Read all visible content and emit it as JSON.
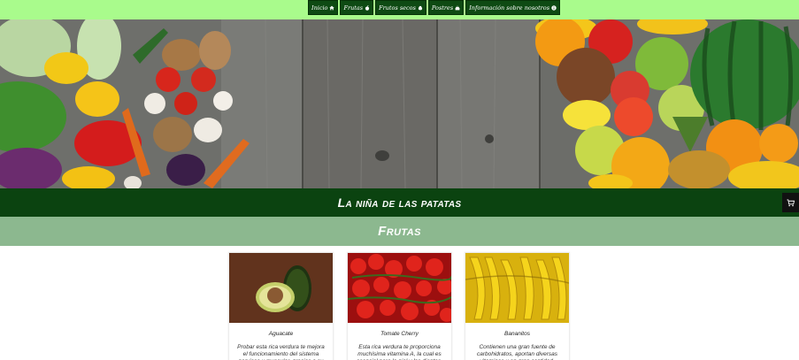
{
  "nav": {
    "items": [
      {
        "label": "Inicio",
        "icon": "home-icon"
      },
      {
        "label": "Frutas",
        "icon": "apple-icon"
      },
      {
        "label": "Frutos secos",
        "icon": "nut-icon"
      },
      {
        "label": "Postres",
        "icon": "cake-icon"
      },
      {
        "label": "Información sobre nosotros",
        "icon": "info-icon"
      }
    ]
  },
  "header": {
    "title": "La niña de las patatas",
    "cart_icon": "cart-icon"
  },
  "section": {
    "title": "Frutas"
  },
  "products": [
    {
      "name": "Aguacate",
      "description": "Probar esta rica verdura te mejora el funcionamiento del sistema nervioso y muscular, gracias a su gran contenido de"
    },
    {
      "name": "Tomate Cherry",
      "description": "Esta rica verdura te proporciona muchísima vitamina A, la cual es esencial para la piel y los dientes."
    },
    {
      "name": "Bananitos",
      "description": "Contienen una gran fuente de carbohidratos, aportan diversas vitaminas y en gran cantidad, además de proteger"
    }
  ],
  "colors": {
    "nav_bg": "#a9fb8c",
    "nav_item_bg": "#0e4a13",
    "title_bar_bg": "#0b4310",
    "section_bar_bg": "#8cb88f",
    "cart_bg": "#111111"
  }
}
